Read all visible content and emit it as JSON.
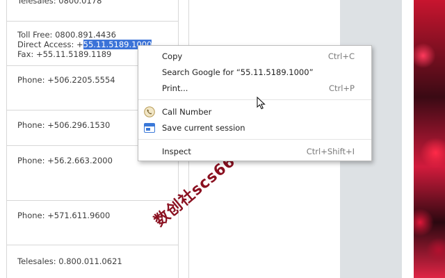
{
  "table": {
    "top_partial": "Telesales: 0800.0178",
    "rows": [
      {
        "lines": [
          "Toll Free: 0800.891.4436"
        ]
      },
      {
        "lines": [
          "Phone: +506.2205.5554"
        ]
      },
      {
        "lines": [
          "Phone: +506.296.1530"
        ]
      },
      {
        "lines": [
          "Phone: +56.2.663.2000"
        ]
      },
      {
        "lines": [
          "Phone: +571.611.9600"
        ]
      },
      {
        "lines": [
          "Telesales: 0.800.011.0621"
        ]
      }
    ],
    "direct_access_prefix": "Direct Access: +",
    "direct_access_selected": "55.11.5189.1000",
    "fax": "Fax: +55.11.5189.1189"
  },
  "context_menu": {
    "items": [
      {
        "label": "Copy",
        "shortcut": "Ctrl+C",
        "icon": ""
      },
      {
        "label": "Search Google for “55.11.5189.1000”",
        "shortcut": "",
        "icon": ""
      },
      {
        "label": "Print...",
        "shortcut": "Ctrl+P",
        "icon": ""
      },
      {
        "label": "Call Number",
        "shortcut": "",
        "icon": "phone-icon"
      },
      {
        "label": "Save current session",
        "shortcut": "",
        "icon": "session-icon"
      },
      {
        "label": "Inspect",
        "shortcut": "Ctrl+Shift+I",
        "icon": ""
      }
    ]
  },
  "watermark": "数创社scs66",
  "colors": {
    "selection": "#3b73d8",
    "menu_border": "#bdbdbd",
    "side_panel": "#dde1e4",
    "watermark": "#8a1020"
  }
}
